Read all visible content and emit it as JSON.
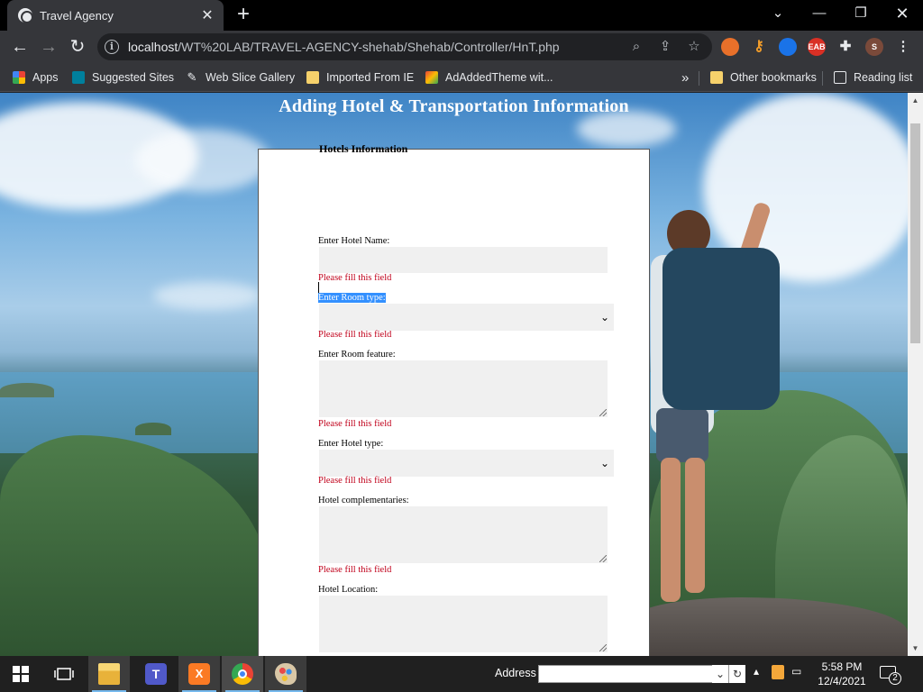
{
  "browser": {
    "tab": {
      "title": "Travel Agency"
    },
    "url": {
      "host": "localhost",
      "path": "/WT%20LAB/TRAVEL-AGENCY-shehab/Shehab/Controller/HnT.php"
    },
    "profile_initial": "S",
    "extension_badge": "EAB"
  },
  "bookmarks": {
    "apps": "Apps",
    "items": [
      "Suggested Sites",
      "Web Slice Gallery",
      "Imported From IE",
      "AdAddedTheme wit..."
    ],
    "overflow": "»",
    "other": "Other bookmarks",
    "reading_list": "Reading list"
  },
  "page": {
    "heading": "Adding Hotel & Transportation Information",
    "fieldset_legend": "Hotels Information",
    "fields": [
      {
        "label": "Enter Hotel Name:",
        "error": "Please fill this field",
        "type": "text",
        "value": ""
      },
      {
        "label": "Enter Room type:",
        "error": "Please fill this field",
        "type": "select",
        "value": ""
      },
      {
        "label": "Enter Room feature:",
        "error": "Please fill this field",
        "type": "textarea",
        "value": ""
      },
      {
        "label": "Enter Hotel type:",
        "error": "Please fill this field",
        "type": "select",
        "value": ""
      },
      {
        "label": "Hotel complementaries:",
        "error": "Please fill this field",
        "type": "textarea",
        "value": ""
      },
      {
        "label": "Hotel Location:",
        "error": "",
        "type": "textarea",
        "value": ""
      }
    ]
  },
  "taskbar": {
    "address_label": "Address",
    "address_value": "",
    "clock_time": "5:58 PM",
    "clock_date": "12/4/2021",
    "notification_count": "2"
  },
  "colors": {
    "error": "#c0001a",
    "selection": "#3390ff",
    "field_bg": "#f0f0f0",
    "chrome_dark": "#35363a"
  }
}
